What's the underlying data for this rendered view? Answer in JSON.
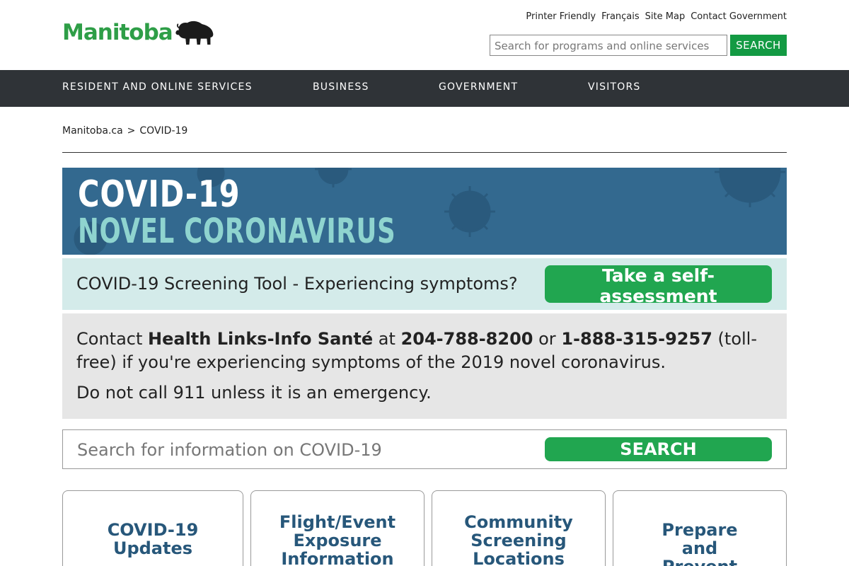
{
  "header": {
    "logo_text": "Manitoba",
    "util_links": [
      "Printer Friendly",
      "Français",
      "Site Map",
      "Contact Government"
    ],
    "search_placeholder": "Search for programs and online services",
    "search_button": "SEARCH"
  },
  "nav": {
    "items": [
      "RESIDENT AND ONLINE SERVICES",
      "BUSINESS",
      "GOVERNMENT",
      "VISITORS"
    ]
  },
  "breadcrumb": {
    "home": "Manitoba.ca",
    "separator": ">",
    "current": "COVID-19"
  },
  "banner": {
    "line1": "COVID-19",
    "line2": "NOVEL CORONAVIRUS"
  },
  "screening": {
    "text": "COVID-19 Screening Tool - Experiencing symptoms?",
    "button": "Take a self-assessment"
  },
  "contact": {
    "prefix": "Contact",
    "org": "Health Links-Info Santé",
    "at": "at",
    "phone1": "204-788-8200",
    "or": "or",
    "phone2": "1-888-315-9257",
    "suffix": "(toll-free) if you're experiencing symptoms of the 2019 novel coronavirus.",
    "emergency": "Do not call 911 unless it is an emergency."
  },
  "covid_search": {
    "placeholder": "Search for information on COVID-19",
    "button": "SEARCH"
  },
  "cards": [
    "COVID-19 Updates",
    "Flight/Event Exposure Information",
    "Community Screening Locations",
    "Prepare and Prevent"
  ],
  "colors": {
    "brand_green": "#2e9e47",
    "button_green": "#21a650",
    "nav_bg": "#2f3337",
    "banner_bg": "#33698f",
    "banner_accent": "#8fd4cf",
    "card_title": "#27577a"
  }
}
